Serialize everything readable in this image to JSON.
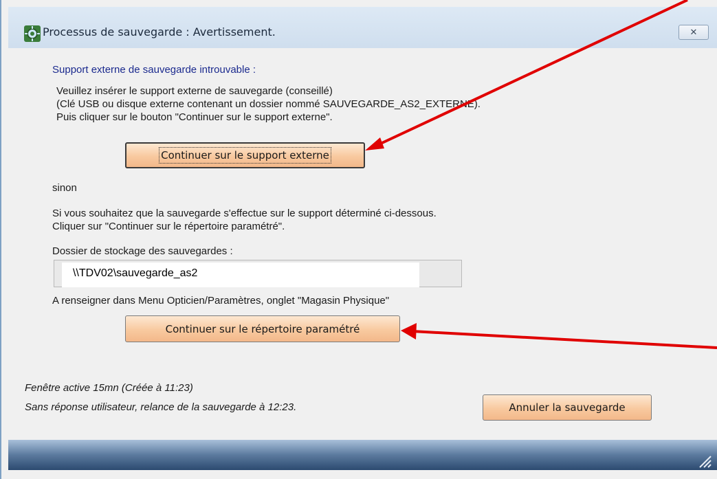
{
  "window": {
    "title": "Processus de sauvegarde : Avertissement.",
    "close_symbol": "✕"
  },
  "external": {
    "heading": "Support externe de sauvegarde introuvable :",
    "line1": "Veuillez insérer le support externe de sauvegarde (conseillé)",
    "line2": "(Clé USB ou disque externe contenant un dossier nommé SAUVEGARDE_AS2_EXTERNE).",
    "line3": "Puis cliquer sur le bouton \"Continuer sur le support externe\".",
    "button": "Continuer sur le support externe"
  },
  "alternative": {
    "sinon": "sinon",
    "line1": "Si vous souhaitez que la sauvegarde s'effectue sur le support déterminé ci-dessous.",
    "line2": "Cliquer sur \"Continuer sur le répertoire paramétré\".",
    "folder_label": "Dossier de stockage des sauvegardes :",
    "folder_value": "\\\\TDV02\\sauvegarde_as2",
    "hint": "A renseigner dans Menu Opticien/Paramètres, onglet \"Magasin Physique\"",
    "button": "Continuer sur le répertoire paramétré"
  },
  "footer": {
    "active": "Fenêtre active 15mn (Créée à 11:23)",
    "relaunch": "Sans réponse utilisateur, relance de la sauvegarde à 12:23.",
    "cancel_button": "Annuler la sauvegarde"
  },
  "colors": {
    "heading": "#1b2a8e",
    "button_orange": "#f8c99f",
    "annotation_arrow": "#e00000"
  },
  "icons": {
    "app": "gear-app-icon",
    "close": "close-icon",
    "grip": "resize-grip-icon"
  }
}
